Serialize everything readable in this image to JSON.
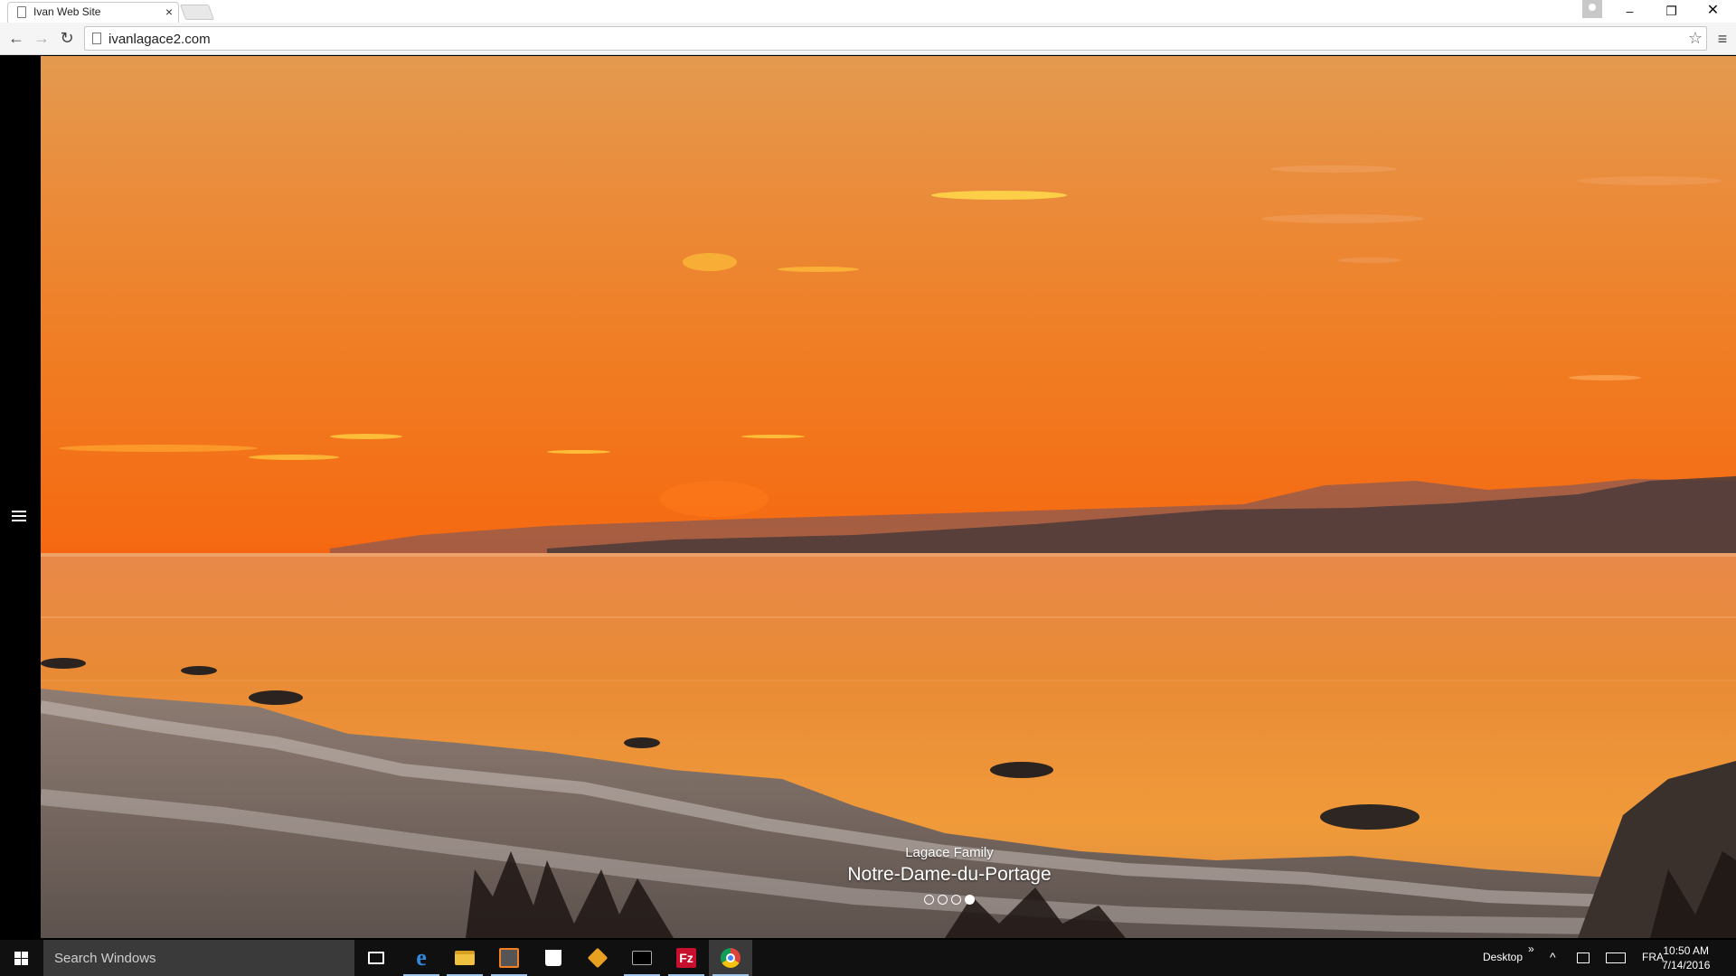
{
  "browser": {
    "tab_title": "Ivan Web Site",
    "tab_close": "×",
    "url": "ivanlagace2.com",
    "window_buttons": {
      "minimize": "–",
      "maximize": "❐",
      "close": "✕"
    },
    "nav": {
      "back": "←",
      "forward": "→",
      "reload": "↻",
      "star": "☆",
      "menu": "≡"
    }
  },
  "hero": {
    "caption_subtitle": "Lagace Family",
    "caption_title": "Notre-Dame-du-Portage",
    "slides_total": 4,
    "active_slide": 4
  },
  "taskbar": {
    "search_placeholder": "Search Windows",
    "apps": [
      "task-view",
      "edge",
      "file-explorer",
      "sublime-text",
      "store",
      "git",
      "terminal",
      "filezilla",
      "chrome"
    ],
    "desktop_label": "Desktop",
    "desktop_chevron": "»",
    "tray_up": "^",
    "language": "FRA",
    "time": "10:50 AM",
    "date": "7/14/2016"
  }
}
